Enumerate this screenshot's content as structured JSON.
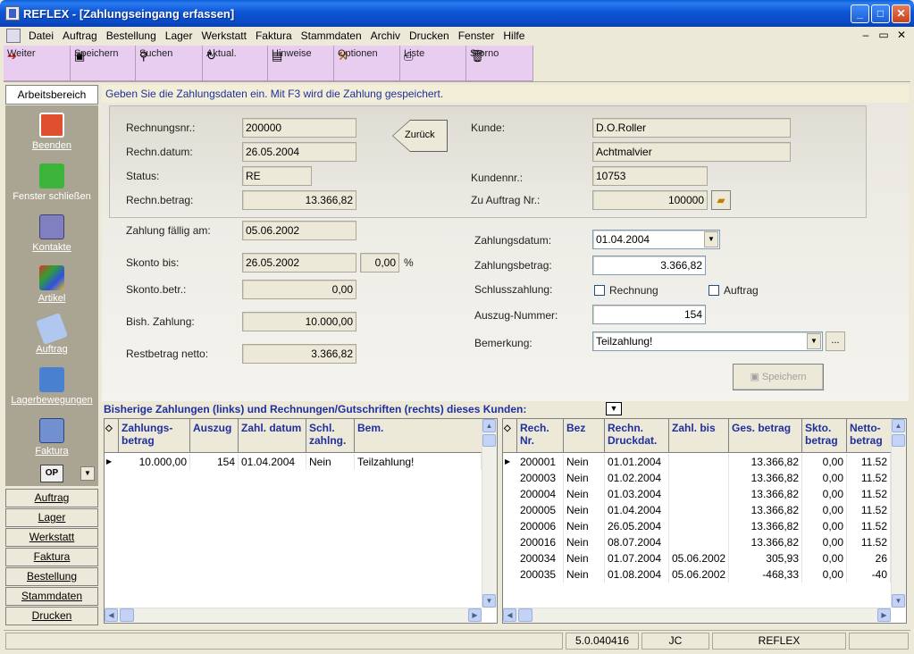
{
  "window": {
    "title": "REFLEX - [Zahlungseingang erfassen]",
    "min": "_",
    "max": "□",
    "close": "✕"
  },
  "menu": [
    "Datei",
    "Auftrag",
    "Bestellung",
    "Lager",
    "Werkstatt",
    "Faktura",
    "Stammdaten",
    "Archiv",
    "Drucken",
    "Fenster",
    "Hilfe"
  ],
  "mdi": {
    "min": "–",
    "restore": "▭",
    "close": "✕"
  },
  "toolbar": [
    "Weiter",
    "Speichern",
    "Suchen",
    "Aktual.",
    "Hinweise",
    "Optionen",
    "Liste",
    "Storno"
  ],
  "sidebar": {
    "header": "Arbeitsbereich",
    "items": [
      "Beenden",
      "Fenster schließen",
      "Kontakte",
      "Artikel",
      "Auftrag",
      "Lagerbewegungen",
      "Faktura"
    ],
    "op_label": "OP",
    "buttons": [
      "Auftrag",
      "Lager",
      "Werkstatt",
      "Faktura",
      "Bestellung",
      "Stammdaten",
      "Drucken"
    ]
  },
  "hint": "Geben Sie die Zahlungsdaten ein. Mit F3 wird die Zahlung gespeichert.",
  "form": {
    "rechnungsnr_label": "Rechnungsnr.:",
    "rechnungsnr": "200000",
    "rechndatum_label": "Rechn.datum:",
    "rechndatum": "26.05.2004",
    "status_label": "Status:",
    "status": "RE",
    "rechnbetrag_label": "Rechn.betrag:",
    "rechnbetrag": "13.366,82",
    "zurueck": "Zurück",
    "kunde_label": "Kunde:",
    "kunde1": "D.O.Roller",
    "kunde2": "Achtmalvier",
    "kundennr_label": "Kundennr.:",
    "kundennr": "10753",
    "zuauftrag_label": "Zu Auftrag Nr.:",
    "zuauftrag": "100000",
    "faellig_label": "Zahlung fällig am:",
    "faellig": "05.06.2002",
    "skontobis_label": "Skonto bis:",
    "skontobis": "26.05.2002",
    "skontoproz": "0,00",
    "proz": "%",
    "skontobetr_label": "Skonto.betr.:",
    "skontobetr": "0,00",
    "bish_label": "Bish. Zahlung:",
    "bish": "10.000,00",
    "rest_label": "Restbetrag netto:",
    "rest": "3.366,82",
    "zahldatum_label": "Zahlungsdatum:",
    "zahldatum": "01.04.2004",
    "zahlbetrag_label": "Zahlungsbetrag:",
    "zahlbetrag": "3.366,82",
    "schluss_label": "Schlusszahlung:",
    "chk_rechnung": "Rechnung",
    "chk_auftrag": "Auftrag",
    "auszug_label": "Auszug-Nummer:",
    "auszug": "154",
    "bemerkung_label": "Bemerkung:",
    "bemerkung": "Teilzahlung!",
    "ellipsis": "...",
    "speichern": "Speichern"
  },
  "list_caption": "Bisherige Zahlungen (links) und Rechnungen/Gutschriften (rechts) dieses Kunden:",
  "payments": {
    "headers": [
      "Zahlungs- betrag",
      "Auszug",
      "Zahl. datum",
      "Schl. zahlng.",
      "Bem."
    ],
    "rows": [
      [
        "10.000,00",
        "154",
        "01.04.2004",
        "Nein",
        "Teilzahlung!"
      ]
    ]
  },
  "invoices": {
    "headers": [
      "Rech. Nr.",
      "Bez",
      "Rechn. Druckdat.",
      "Zahl. bis",
      "Ges. betrag",
      "Skto. betrag",
      "Netto- betrag"
    ],
    "rows": [
      [
        "200001",
        "Nein",
        "01.01.2004",
        "",
        "13.366,82",
        "0,00",
        "11.52"
      ],
      [
        "200003",
        "Nein",
        "01.02.2004",
        "",
        "13.366,82",
        "0,00",
        "11.52"
      ],
      [
        "200004",
        "Nein",
        "01.03.2004",
        "",
        "13.366,82",
        "0,00",
        "11.52"
      ],
      [
        "200005",
        "Nein",
        "01.04.2004",
        "",
        "13.366,82",
        "0,00",
        "11.52"
      ],
      [
        "200006",
        "Nein",
        "26.05.2004",
        "",
        "13.366,82",
        "0,00",
        "11.52"
      ],
      [
        "200016",
        "Nein",
        "08.07.2004",
        "",
        "13.366,82",
        "0,00",
        "11.52"
      ],
      [
        "200034",
        "Nein",
        "01.07.2004",
        "05.06.2002",
        "305,93",
        "0,00",
        "26"
      ],
      [
        "200035",
        "Nein",
        "01.08.2004",
        "05.06.2002",
        "-468,33",
        "0,00",
        "-40"
      ]
    ]
  },
  "status": {
    "version": "5.0.040416",
    "user": "JC",
    "app": "REFLEX"
  }
}
